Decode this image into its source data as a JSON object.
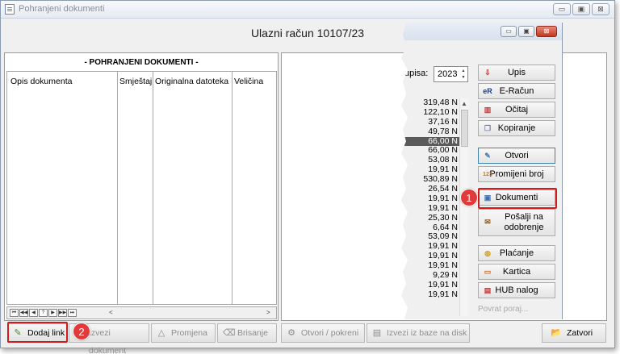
{
  "window": {
    "title": "Pohranjeni dokumenti",
    "controls": {
      "minimize": "▭",
      "maximize": "▣",
      "close": "⊠"
    }
  },
  "heading": "Ulazni račun 10107/23",
  "stored_docs": {
    "title": "- POHRANJENI DOKUMENTI -",
    "columns": [
      "Opis dokumenta",
      "Smještaj",
      "Originalna datoteka",
      "Veličina"
    ],
    "nav_buttons": [
      "⏮",
      "◀◀",
      "◀",
      "?",
      "▶",
      "▶▶",
      "⏭"
    ],
    "scroll_left": "<",
    "scroll_right": ">"
  },
  "bottom_buttons": {
    "dodaj_link": "Dodaj link",
    "izvezi_dokument": "Izvezi dokument",
    "promjena": "Promjena",
    "brisanje": "Brisanje",
    "otvori_pokreni": "Otvori / pokreni",
    "izvezi_iz_baze": "Izvezi iz baze na disk",
    "zatvori": "Zatvori"
  },
  "overlay": {
    "year_label": "upisa:",
    "year_value": "2023",
    "amounts": [
      "319,48 N",
      "122,10 N",
      "37,16 N",
      "49,78 N",
      "66,00 N",
      "66,00 N",
      "53,08 N",
      "19,91 N",
      "530,89 N",
      "26,54 N",
      "19,91 N",
      "19,91 N",
      "25,30 N",
      "6,64 N",
      "53,09 N",
      "19,91 N",
      "19,91 N",
      "19,91 N",
      "9,29 N",
      "19,91 N",
      "19,91 N"
    ],
    "selected_index": 4,
    "buttons": {
      "upis": "Upis",
      "e_racun": "E-Račun",
      "ocitaj": "Očitaj",
      "kopiranje": "Kopiranje",
      "otvori": "Otvori",
      "promijeni_broj": "Promijeni broj",
      "dokumenti": "Dokumenti",
      "posalji_line1": "Pošalji na",
      "posalji_line2": "odobrenje",
      "placanje": "Plaćanje",
      "kartica": "Kartica",
      "hub_nalog": "HUB nalog"
    },
    "faded_text": "Povrat poraj..."
  },
  "badges": {
    "one": "1",
    "two": "2"
  }
}
